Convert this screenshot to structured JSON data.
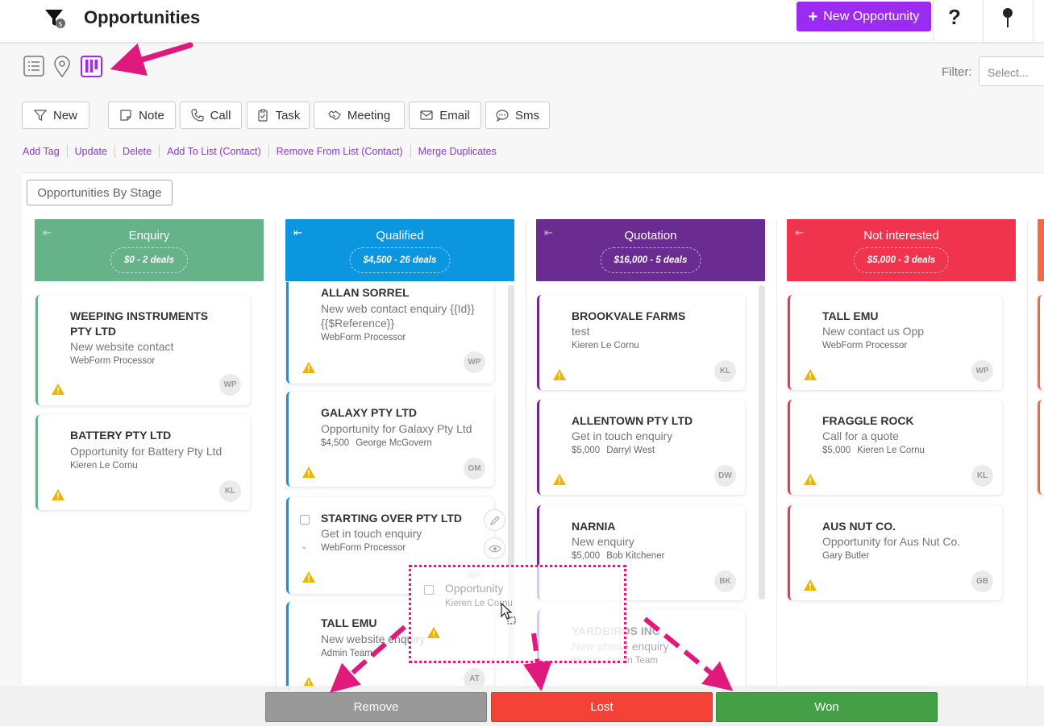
{
  "header": {
    "title": "Opportunities",
    "new_button": "New Opportunity"
  },
  "toolbar": {
    "filter_label": "Filter:",
    "filter_placeholder": "Select...",
    "buttons": [
      "New",
      "Note",
      "Call",
      "Task",
      "Meeting",
      "Email",
      "Sms"
    ],
    "links": [
      "Add Tag",
      "Update",
      "Delete",
      "Add To List (Contact)",
      "Remove From List (Contact)",
      "Merge Duplicates"
    ]
  },
  "board": {
    "view_label": "Opportunities By Stage",
    "columns": [
      {
        "name": "Enquiry",
        "summary": "$0 - 2 deals",
        "color": "#66b38a",
        "cards": [
          {
            "name": "WEEPING INSTRUMENTS PTY LTD",
            "desc": "New website contact",
            "amount": "",
            "owner": "WebForm Processor",
            "initials": "WP"
          },
          {
            "name": "BATTERY PTY LTD",
            "desc": "Opportunity for Battery Pty Ltd",
            "amount": "",
            "owner": "Kieren Le Cornu",
            "initials": "KL"
          }
        ]
      },
      {
        "name": "Qualified",
        "summary": "$4,500 - 26 deals",
        "color": "#0c96e0",
        "cards": [
          {
            "name": "ALLAN SORREL",
            "desc": "New web contact enquiry {{Id}} {{$Reference}}",
            "amount": "",
            "owner": "WebForm Processor",
            "initials": "WP"
          },
          {
            "name": "GALAXY PTY LTD",
            "desc": "Opportunity for Galaxy Pty Ltd",
            "amount": "$4,500",
            "owner": "George McGovern",
            "initials": "GM"
          },
          {
            "name": "STARTING OVER PTY LTD",
            "desc": "Get in touch enquiry",
            "amount": "",
            "owner": "WebForm Processor",
            "initials": "WP"
          },
          {
            "name": "TALL EMU",
            "desc": "New website enquiry",
            "amount": "",
            "owner": "Admin Team",
            "initials": "AT"
          }
        ]
      },
      {
        "name": "Quotation",
        "summary": "$16,000 - 5 deals",
        "color": "#6a2c91",
        "cards": [
          {
            "name": "BROOKVALE FARMS",
            "desc": "test",
            "amount": "",
            "owner": "Kieren Le Cornu",
            "initials": "KL"
          },
          {
            "name": "ALLENTOWN PTY LTD",
            "desc": "Get in touch enquiry",
            "amount": "$5,000",
            "owner": "Darryl West",
            "initials": "DW"
          },
          {
            "name": "NARNIA",
            "desc": "New enquiry",
            "amount": "$5,000",
            "owner": "Bob Kitchener",
            "initials": "BK"
          },
          {
            "name": "YARDBIRDS INC",
            "desc": "New phone enquiry",
            "amount": "$5,000",
            "owner": "Admin Team",
            "initials": "KL"
          }
        ]
      },
      {
        "name": "Not interested",
        "summary": "$5,000 - 3 deals",
        "color": "#f0344d",
        "cards": [
          {
            "name": "TALL EMU",
            "desc": "New contact us Opp",
            "amount": "",
            "owner": "WebForm Processor",
            "initials": "WP"
          },
          {
            "name": "FRAGGLE ROCK",
            "desc": "Call for a quote",
            "amount": "$5,000",
            "owner": "Kieren Le Cornu",
            "initials": "KL"
          },
          {
            "name": "AUS NUT CO.",
            "desc": "Opportunity for Aus Nut Co.",
            "amount": "",
            "owner": "Gary Butler",
            "initials": "GB"
          }
        ]
      }
    ]
  },
  "drag_ghost": {
    "title": "Opportunity",
    "owner": "Kieren Le Cornu"
  },
  "actions": {
    "remove": "Remove",
    "lost": "Lost",
    "won": "Won"
  },
  "colors": {
    "accent": "#9b2bf0",
    "annotation": "#e0197d",
    "remove": "#999999",
    "lost": "#f44336",
    "won": "#43a047",
    "warning": "#f0b400"
  }
}
